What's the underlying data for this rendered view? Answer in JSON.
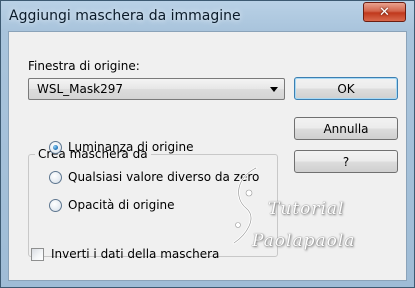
{
  "window": {
    "title": "Aggiungi maschera da immagine",
    "close_glyph": "✕"
  },
  "source": {
    "label": "Finestra di origine:",
    "selected": "WSL_Mask297"
  },
  "buttons": {
    "ok": "OK",
    "cancel": "Annulla",
    "help": "?"
  },
  "group": {
    "legend": "Crea maschera da",
    "options": [
      {
        "label": "Luminanza di origine",
        "checked": true
      },
      {
        "label": "Qualsiasi valore diverso da zero",
        "checked": false
      },
      {
        "label": "Opacità di origine",
        "checked": false
      }
    ]
  },
  "invert": {
    "label": "Inverti i dati della maschera",
    "checked": false
  },
  "watermark": {
    "line1": "Tutorial",
    "line2": "Paolapaola"
  },
  "colors": {
    "title_bar": "#a9c4dc",
    "close_button": "#c0391d",
    "client_bg": "#f0f0f0",
    "radio_selected": "#1c6fb7"
  }
}
